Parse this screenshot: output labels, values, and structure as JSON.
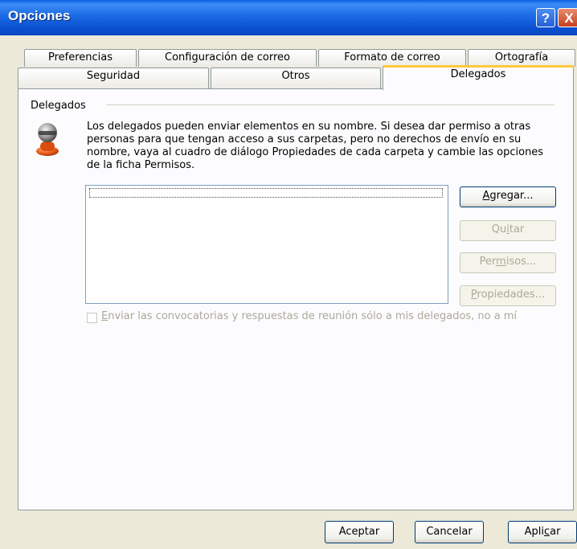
{
  "window": {
    "title": "Opciones"
  },
  "titlebar": {
    "help_glyph": "?",
    "close_glyph": "X"
  },
  "tabs": {
    "row1": [
      "Preferencias",
      "Configuración de correo",
      "Formato de correo",
      "Ortografía"
    ],
    "row2": [
      "Seguridad",
      "Otros",
      "Delegados"
    ],
    "active": "Delegados"
  },
  "delegates": {
    "group_label": "Delegados",
    "description_lines": [
      "Los delegados pueden enviar elementos en su nombre. Si desea dar permiso a otras",
      "personas para que tengan acceso a sus carpetas, pero no derechos de envío en su",
      "nombre, vaya al cuadro de diálogo Propiedades de cada carpeta y cambie las opciones",
      "de la ficha Permisos."
    ],
    "icon": "user-delegate-icon",
    "buttons": {
      "add": {
        "label": "Agregar...",
        "accel": "A",
        "rest": "gregar...",
        "enabled": true
      },
      "remove": {
        "label": "Quitar",
        "pre": "Qu",
        "accel": "i",
        "rest": "tar",
        "enabled": false
      },
      "permissions": {
        "label": "Permisos...",
        "pre": "Per",
        "accel": "m",
        "rest": "isos...",
        "enabled": false
      },
      "properties": {
        "label": "Propiedades...",
        "accel": "P",
        "rest": "ropiedades...",
        "enabled": false
      }
    },
    "checkbox": {
      "label": "Enviar las convocatorias y respuestas de reunión sólo a mis delegados, no a mí",
      "accel": "E",
      "rest": "nviar las convocatorias y respuestas de reunión sólo a mis delegados, no a mí",
      "checked": false,
      "enabled": false
    }
  },
  "footer": {
    "ok": "Aceptar",
    "cancel": "Cancelar",
    "apply": {
      "label": "Aplicar",
      "pre": "Apli",
      "accel": "c",
      "rest": "ar"
    }
  },
  "colors": {
    "accent_tab": "#FFC83C",
    "titlebar": "#0A5FE0",
    "dialog_bg": "#ECE9D8"
  }
}
